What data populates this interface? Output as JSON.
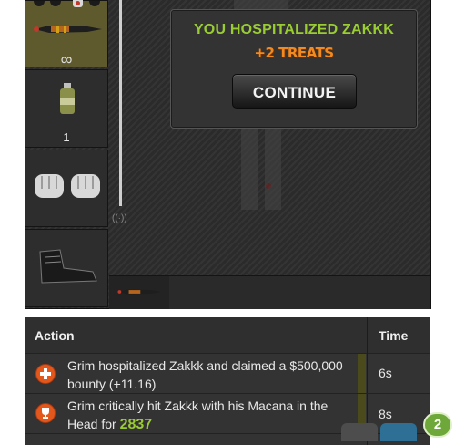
{
  "result": {
    "title": "YOU HOSPITALIZED ZAKKK",
    "reward": "+2 TREATS",
    "continue_label": "CONTINUE"
  },
  "weapons": {
    "primary": {
      "name": "Macana",
      "ammo": "∞"
    },
    "temporary": {
      "ammo": "1"
    }
  },
  "log": {
    "headers": {
      "action": "Action",
      "time": "Time"
    },
    "rows": [
      {
        "icon": "hospital-cross-icon",
        "text": "Grim hospitalized Zakkk and claimed a $500,000 bounty (+11.16)",
        "time": "6s"
      },
      {
        "icon": "trophy-icon",
        "text_before": "Grim critically hit Zakkk with his Macana in the Head for",
        "damage": "2837",
        "time": "8s"
      }
    ]
  },
  "chat": {
    "badge_count": "2"
  },
  "colors": {
    "accent_green": "#9acd32",
    "reward_orange": "#f28a1f",
    "icon_orange": "#e2571b"
  }
}
